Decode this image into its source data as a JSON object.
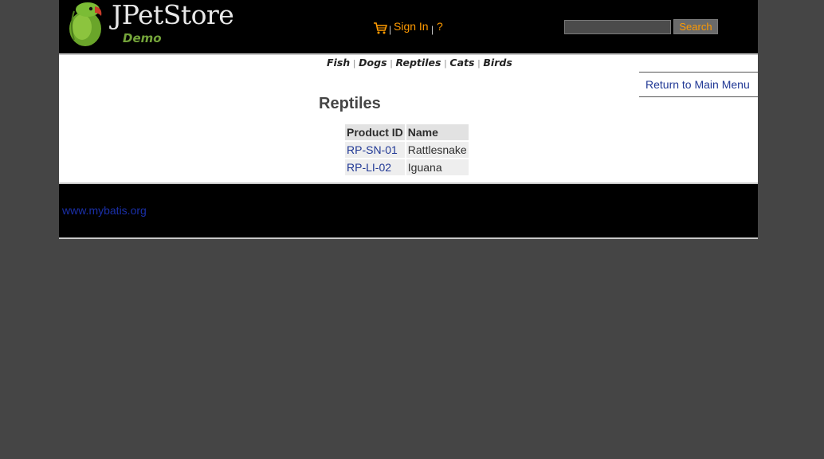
{
  "header": {
    "logo_text": "JPetStore",
    "logo_subtext": "Demo",
    "menu": {
      "sign_in": "Sign In",
      "help": "?"
    },
    "search": {
      "value": "",
      "button_label": "Search"
    }
  },
  "quicklinks": [
    "Fish",
    "Dogs",
    "Reptiles",
    "Cats",
    "Birds"
  ],
  "back_link": "Return to Main Menu",
  "catalog": {
    "category_title": "Reptiles",
    "columns": [
      "Product ID",
      "Name"
    ],
    "products": [
      {
        "product_id": "RP-SN-01",
        "name": "Rattlesnake"
      },
      {
        "product_id": "RP-LI-02",
        "name": "Iguana"
      }
    ]
  },
  "footer": {
    "link_text": "www.mybatis.org"
  },
  "colors": {
    "page_background": "#454545",
    "header_background": "#000000",
    "menu_accent": "#ff9a00",
    "link": "#203895",
    "footer_link": "#1a2fa8"
  }
}
